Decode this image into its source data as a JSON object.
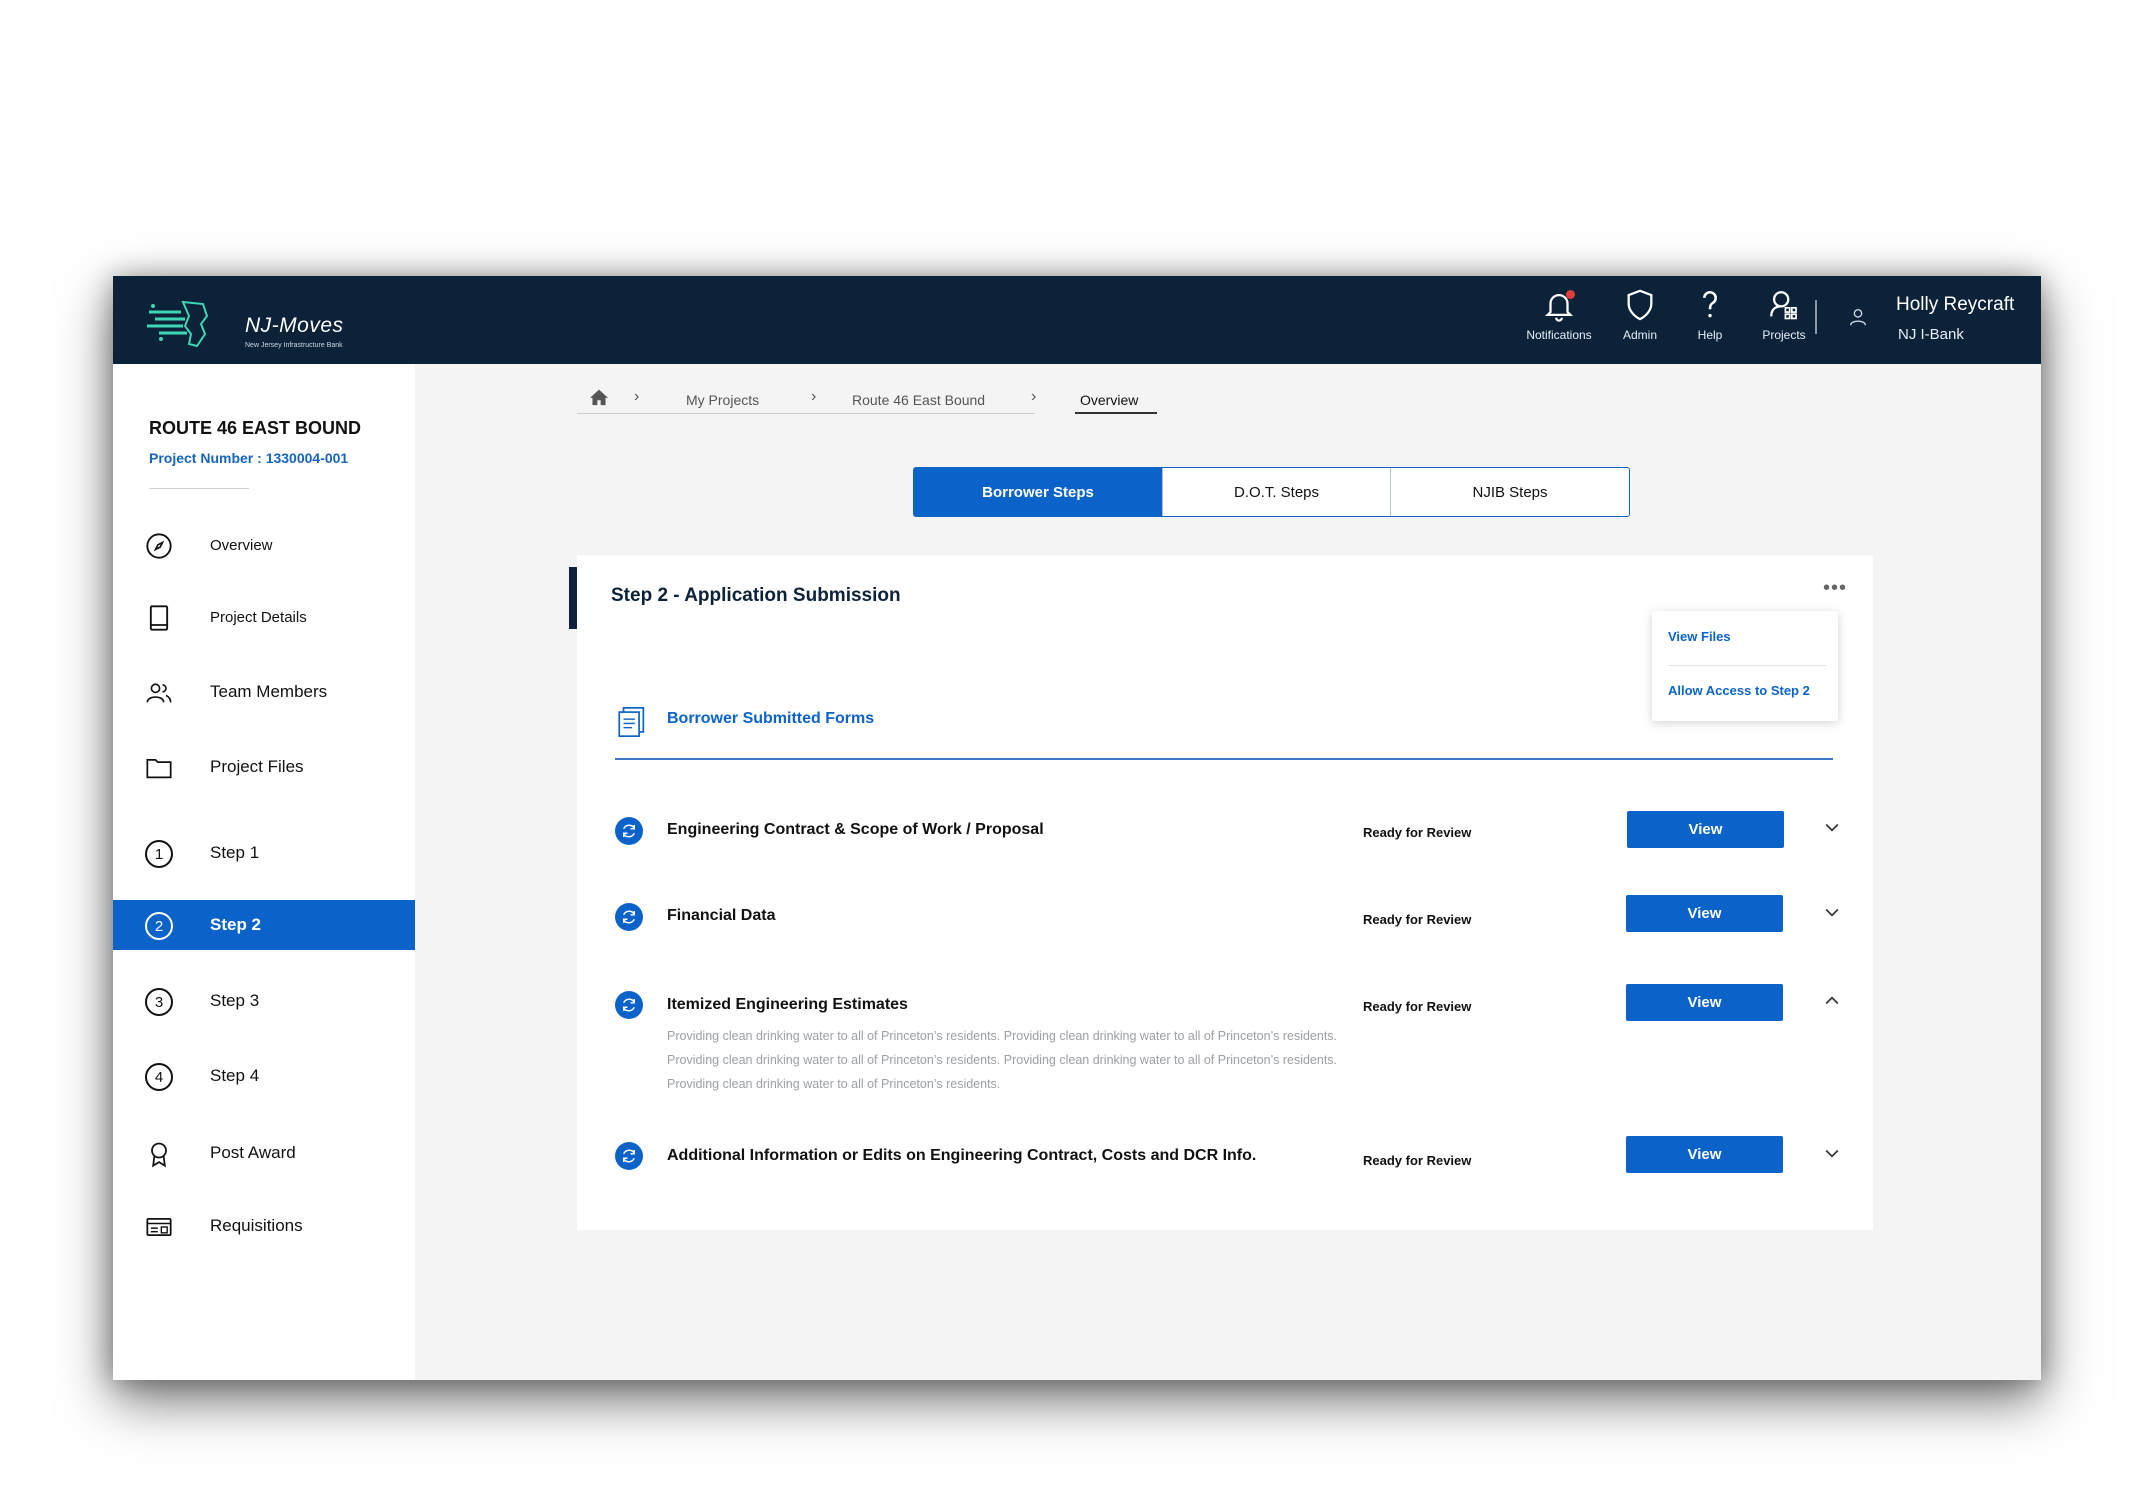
{
  "app": {
    "logo_text": "NJ-Moves",
    "logo_sub": "New Jersey Infrastructure Bank"
  },
  "topnav": {
    "items": [
      {
        "label": "Notifications",
        "icon": "bell-icon"
      },
      {
        "label": "Admin",
        "icon": "shield-icon"
      },
      {
        "label": "Help",
        "icon": "question-icon"
      },
      {
        "label": "Projects",
        "icon": "projects-icon"
      }
    ],
    "user_name": "Holly Reycraft",
    "user_org": "NJ I-Bank"
  },
  "sidebar": {
    "project_title": "ROUTE 46 EAST BOUND",
    "project_number": "Project Number : 1330004-001",
    "items": [
      {
        "label": "Overview",
        "icon": "compass-icon"
      },
      {
        "label": "Project Details",
        "icon": "book-icon"
      },
      {
        "label": "Team Members",
        "icon": "team-icon"
      },
      {
        "label": "Project Files",
        "icon": "folder-icon"
      },
      {
        "label": "Step 1",
        "num": "1"
      },
      {
        "label": "Step 2",
        "num": "2",
        "active": true
      },
      {
        "label": "Step 3",
        "num": "3"
      },
      {
        "label": "Step 4",
        "num": "4"
      },
      {
        "label": "Post Award",
        "icon": "award-icon"
      },
      {
        "label": "Requisitions",
        "icon": "requisitions-icon"
      }
    ]
  },
  "breadcrumb": {
    "items": [
      "My Projects",
      "Route 46 East Bound",
      "Overview"
    ]
  },
  "tabs": [
    {
      "label": "Borrower Steps",
      "active": true
    },
    {
      "label": "D.O.T. Steps"
    },
    {
      "label": "NJIB Steps"
    }
  ],
  "card": {
    "title": "Step 2 - Application Submission",
    "menu": [
      "View Files",
      "Allow Access to Step 2"
    ],
    "section_title": "Borrower Submitted Forms",
    "rows": [
      {
        "title": "Engineering Contract & Scope of Work / Proposal",
        "status": "Ready for Review",
        "button": "View",
        "expanded": false
      },
      {
        "title": "Financial Data",
        "status": "Ready for Review",
        "button": "View",
        "expanded": false
      },
      {
        "title": "Itemized Engineering Estimates",
        "status": "Ready for Review",
        "button": "View",
        "expanded": true
      },
      {
        "title": "Additional Information or Edits on Engineering Contract, Costs and DCR Info.",
        "status": "Ready for Review",
        "button": "View",
        "expanded": false
      }
    ],
    "expanded_description": [
      "Providing clean drinking water to all of Princeton’s residents. Providing clean drinking water to all of Princeton’s residents.",
      "Providing clean drinking water to all of Princeton’s residents. Providing clean drinking water to all of Princeton’s residents.",
      "Providing clean drinking water to all of Princeton’s residents."
    ]
  },
  "colors": {
    "navy": "#0c2238",
    "accent": "#0b63c9",
    "notification_dot": "#e43b3b"
  }
}
